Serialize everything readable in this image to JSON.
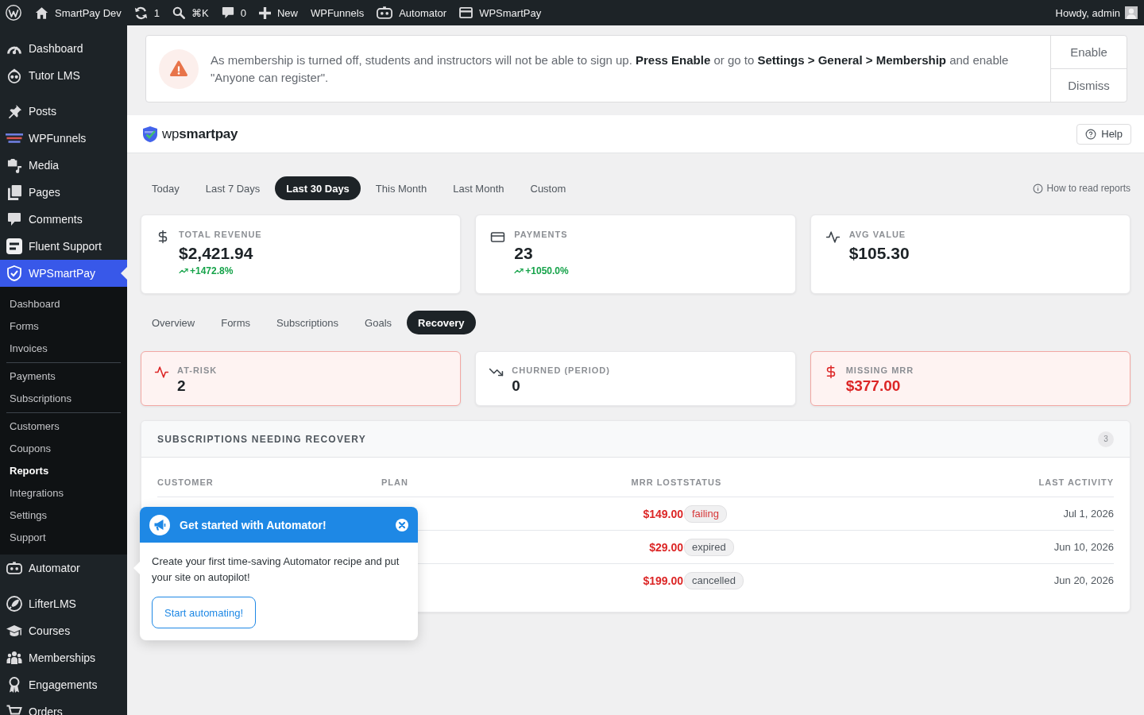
{
  "admin_bar": {
    "items": [
      {
        "label": "SmartPay Dev"
      },
      {
        "label": "1"
      },
      {
        "label": "⌘K"
      },
      {
        "label": "0"
      },
      {
        "label": "New"
      },
      {
        "label": "WPFunnels"
      },
      {
        "label": "Automator"
      },
      {
        "label": "WPSmartPay"
      }
    ],
    "account": "Howdy, admin"
  },
  "sidebar": {
    "groups": [
      {
        "items": [
          {
            "label": "Dashboard",
            "selected": false
          },
          {
            "label": "Tutor LMS",
            "selected": false
          }
        ]
      },
      {
        "items": [
          {
            "label": "Posts",
            "selected": false
          },
          {
            "label": "WPFunnels",
            "selected": false
          },
          {
            "label": "Media",
            "selected": false
          },
          {
            "label": "Pages",
            "selected": false
          },
          {
            "label": "Comments",
            "selected": false
          },
          {
            "label": "Fluent Support",
            "selected": false
          },
          {
            "label": "WPSmartPay",
            "selected": true,
            "submenu": [
              {
                "items": [
                  {
                    "label": "Dashboard",
                    "selected": false
                  },
                  {
                    "label": "Forms",
                    "selected": false
                  },
                  {
                    "label": "Invoices",
                    "selected": false
                  }
                ]
              },
              {
                "items": [
                  {
                    "label": "Payments",
                    "selected": false
                  },
                  {
                    "label": "Subscriptions",
                    "selected": false
                  }
                ]
              },
              {
                "items": [
                  {
                    "label": "Customers",
                    "selected": false
                  },
                  {
                    "label": "Coupons",
                    "selected": false
                  },
                  {
                    "label": "Reports",
                    "selected": true
                  },
                  {
                    "label": "Integrations",
                    "selected": false
                  },
                  {
                    "label": "Settings",
                    "selected": false
                  },
                  {
                    "label": "Support",
                    "selected": false
                  }
                ]
              }
            ]
          },
          {
            "label": "Automator",
            "selected": false
          }
        ]
      },
      {
        "items": [
          {
            "label": "LifterLMS",
            "selected": false
          },
          {
            "label": "Courses",
            "selected": false
          },
          {
            "label": "Memberships",
            "selected": false
          },
          {
            "label": "Engagements",
            "selected": false
          },
          {
            "label": "Orders",
            "selected": false
          }
        ]
      }
    ]
  },
  "notice": {
    "message": "As membership is turned off, students and instructors will not be able to sign up. **Press Enable** or go to **Settings > General > Membership** and enable \"Anyone can register\".",
    "buttons": [
      "Enable",
      "Dismiss"
    ]
  },
  "header": {
    "brand": "wp**smartpay**",
    "help": "Help"
  },
  "reports": {
    "date_ranges": [
      {
        "label": "Today",
        "selected": false
      },
      {
        "label": "Last 7 Days",
        "selected": false
      },
      {
        "label": "Last 30 Days",
        "selected": true
      },
      {
        "label": "This Month",
        "selected": false
      },
      {
        "label": "Last Month",
        "selected": false
      },
      {
        "label": "Custom",
        "selected": false
      }
    ],
    "guide_link": "How to read reports",
    "stats": [
      {
        "label": "TOTAL REVENUE",
        "value": "$2,421.94",
        "change": "+1472.8%"
      },
      {
        "label": "PAYMENTS",
        "value": "23",
        "change": "+1050.0%"
      },
      {
        "label": "AVG VALUE",
        "value": "$105.30"
      }
    ],
    "tabs": [
      {
        "label": "Overview",
        "selected": false
      },
      {
        "label": "Forms",
        "selected": false
      },
      {
        "label": "Subscriptions",
        "selected": false
      },
      {
        "label": "Goals",
        "selected": false
      },
      {
        "label": "Recovery",
        "selected": true
      }
    ],
    "recovery_cards": [
      {
        "label": "AT-RISK",
        "value": "2",
        "alert": true,
        "value_alert": false
      },
      {
        "label": "CHURNED (PERIOD)",
        "value": "0",
        "alert": false,
        "value_alert": false
      },
      {
        "label": "MISSING MRR",
        "value": "$377.00",
        "alert": true,
        "value_alert": true
      }
    ]
  },
  "table": {
    "title": "SUBSCRIPTIONS NEEDING RECOVERY",
    "count": "3",
    "columns": [
      "CUSTOMER",
      "PLAN",
      "MRR LOST",
      "STATUS",
      "LAST ACTIVITY"
    ],
    "rows": [
      {
        "mrr_lost": "$149.00",
        "status": {
          "label": "failing",
          "color": "#d63638"
        },
        "last_activity": "Jul 1, 2026"
      },
      {
        "mrr_lost": "$29.00",
        "status": {
          "label": "expired",
          "color": "#50575e"
        },
        "last_activity": "Jun 10, 2026"
      },
      {
        "mrr_lost": "$199.00",
        "status": {
          "label": "cancelled",
          "color": "#50575e"
        },
        "last_activity": "Jun 20, 2026"
      }
    ]
  },
  "popup": {
    "title": "Get started with Automator!",
    "text": "Create your first time-saving Automator recipe and put your site on autopilot!",
    "button": "Start automating!"
  }
}
